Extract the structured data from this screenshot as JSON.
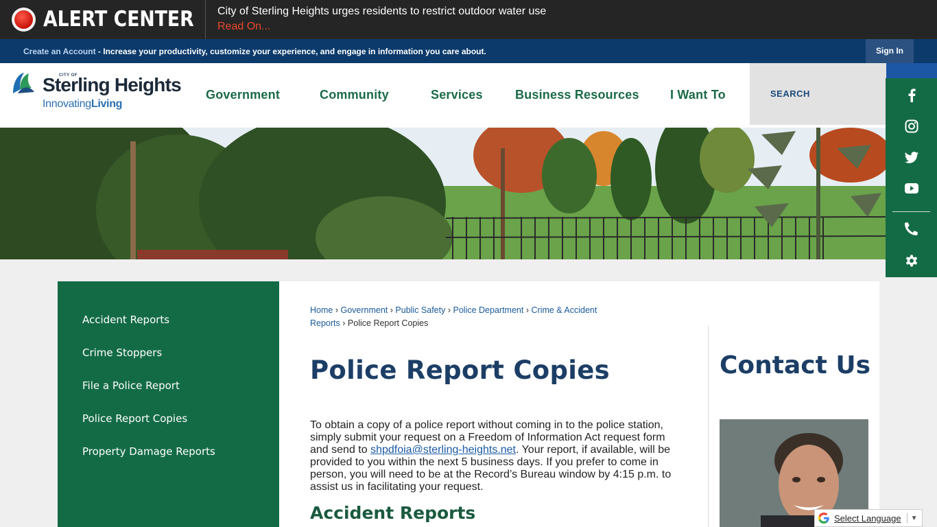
{
  "alert": {
    "title": "ALERT CENTER",
    "message": "City of Sterling Heights urges residents to restrict outdoor water use",
    "link": "Read On..."
  },
  "account": {
    "create_link": "Create an Account",
    "tagline": " - Increase your productivity, customize your experience, and engage in information you care about.",
    "signin": "Sign In"
  },
  "logo": {
    "city_of": "CITY OF",
    "name": "Sterling Heights",
    "tag_a": "Innovating",
    "tag_b": "Living"
  },
  "nav": {
    "items": [
      {
        "label": "Government"
      },
      {
        "label": "Community"
      },
      {
        "label": "Services"
      },
      {
        "label": "Business Resources"
      },
      {
        "label": "I Want To"
      }
    ],
    "search_label": "SEARCH"
  },
  "social": {
    "icons": [
      "facebook-icon",
      "instagram-icon",
      "twitter-icon",
      "youtube-icon",
      "phone-icon",
      "gear-icon"
    ]
  },
  "sidebar": {
    "items": [
      {
        "label": "Accident Reports"
      },
      {
        "label": "Crime Stoppers"
      },
      {
        "label": "File a Police Report"
      },
      {
        "label": "Police Report Copies"
      },
      {
        "label": "Property Damage Reports"
      }
    ]
  },
  "breadcrumb": {
    "items": [
      "Home",
      "Government",
      "Public Safety",
      "Police Department",
      "Crime & Accident Reports"
    ],
    "current": "Police Report Copies",
    "separator": "›"
  },
  "main": {
    "title": "Police Report Copies",
    "paragraph_before": "To obtain a copy of a police report without coming in to the police station, simply submit your request on a Freedom of Information Act request form and send to ",
    "email": "shpdfoia@sterling-heights.net",
    "paragraph_after": ". Your report, if available, will be provided to you within the next 5 business days. If you prefer to come in person, you will need to be at the Record’s Bureau window by 4:15 p.m. to assist us in facilitating your request.",
    "subheading": "Accident Reports"
  },
  "contact": {
    "title": "Contact Us"
  },
  "translate": {
    "label": "Select Language",
    "arrow": "▼"
  },
  "colors": {
    "brand_green": "#136b46",
    "brand_blue": "#0b3a6b",
    "alert_red": "#e8492d",
    "title_navy": "#1c3e66"
  }
}
